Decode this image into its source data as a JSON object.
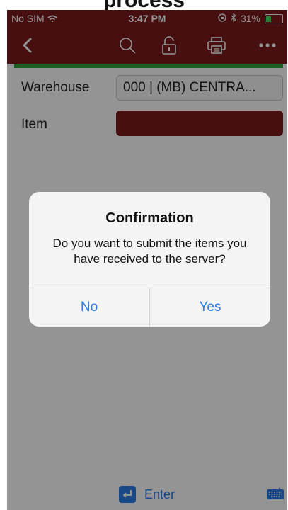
{
  "cropped_header": "process",
  "status_bar": {
    "carrier": "No SIM",
    "time": "3:47 PM",
    "battery": "31%",
    "battery_level": 0.31
  },
  "nav": {
    "icons": [
      "back-icon",
      "search-icon",
      "unlock-icon",
      "print-icon",
      "more-icon"
    ]
  },
  "form": {
    "warehouse_label": "Warehouse",
    "warehouse_value": "000 | (MB) CENTRA...",
    "item_label": "Item",
    "item_value": ""
  },
  "bottom": {
    "enter_label": "Enter"
  },
  "dialog": {
    "title": "Confirmation",
    "message": "Do you want to submit the items you have received to the server?",
    "no_label": "No",
    "yes_label": "Yes"
  },
  "colors": {
    "brand": "#7a1a1a",
    "accent": "#2b7de9",
    "progress": "#2fa33a"
  }
}
